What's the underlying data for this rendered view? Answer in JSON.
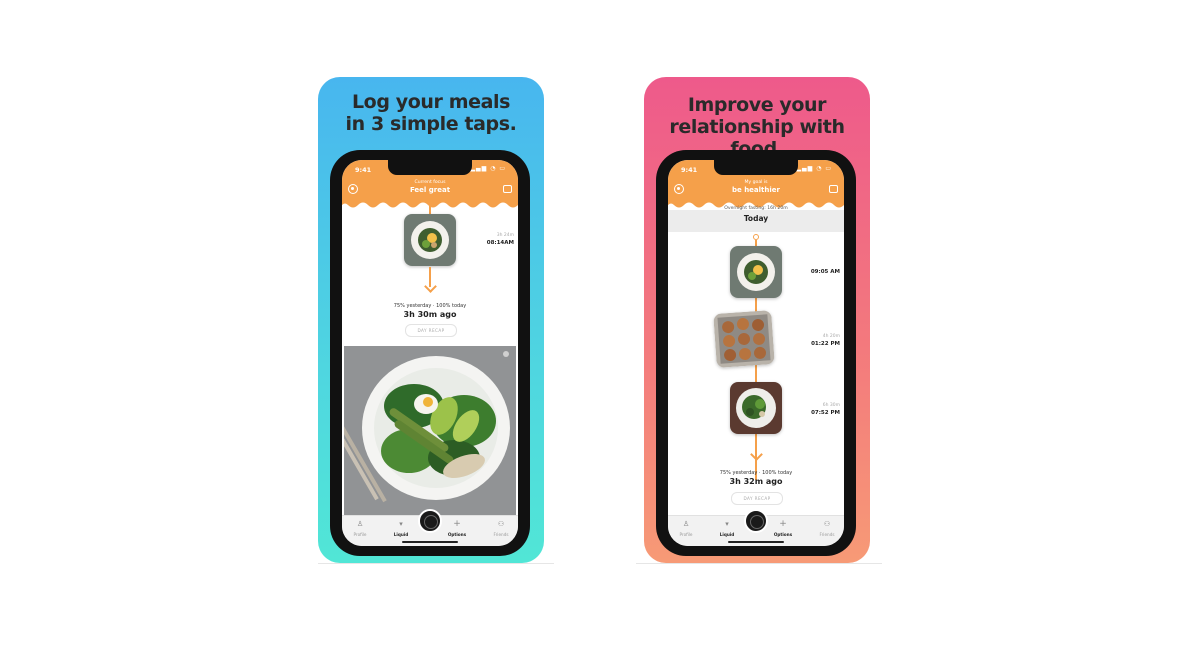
{
  "left_card": {
    "headline_line1": "Log your meals",
    "headline_line2": "in 3 simple taps.",
    "status_time": "9:41",
    "header_subtitle": "Current focus",
    "header_title": "Feel great",
    "meal_ago": "3h 24m",
    "meal_time": "08:14AM",
    "summary": "75% yesterday · 100% today",
    "time_since": "3h 30m ago",
    "day_recap": "DAY RECAP",
    "tabs": [
      "Profile",
      "Liquid",
      "Options",
      "Friends"
    ]
  },
  "right_card": {
    "headline_line1": "Improve your",
    "headline_line2": "relationship with food.",
    "status_time": "9:41",
    "header_subtitle": "My goal is",
    "header_title": "be healthier",
    "fasting": "Overnight fasting: 16h 20m",
    "today": "Today",
    "meals": [
      {
        "ago": "",
        "time": "09:05 AM"
      },
      {
        "ago": "4h 20m",
        "time": "01:22 PM"
      },
      {
        "ago": "6h 30m",
        "time": "07:52 PM"
      }
    ],
    "summary": "75% yesterday · 100% today",
    "time_since": "3h 32m ago",
    "day_recap": "DAY RECAP",
    "tabs": [
      "Profile",
      "Liquid",
      "Options",
      "Friends"
    ]
  },
  "colors": {
    "accent_orange": "#f5a04a",
    "left_bg": "#48b6ef",
    "right_bg": "#ee5a8b"
  },
  "icons": [
    "settings-gear-icon",
    "photo-icon",
    "profile-icon",
    "cup-icon",
    "camera-icon",
    "plus-icon",
    "friends-icon",
    "arrow-down-icon"
  ]
}
